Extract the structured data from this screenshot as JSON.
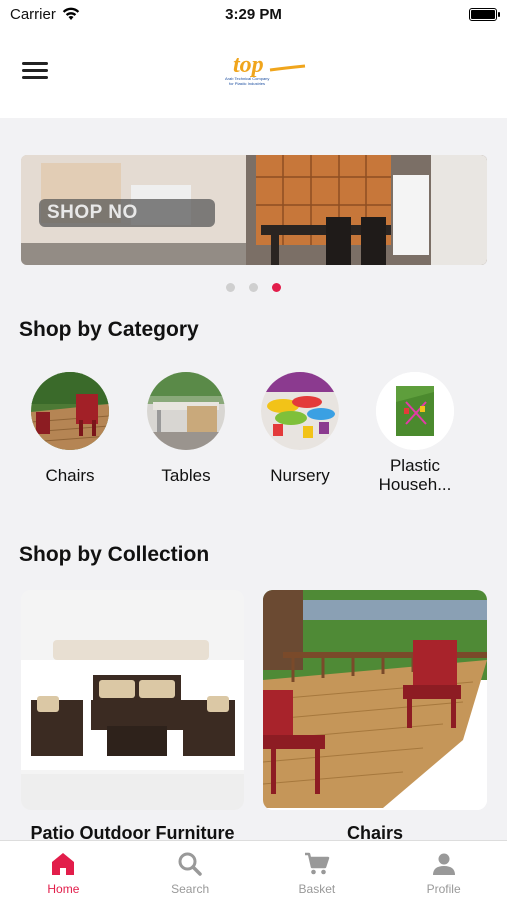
{
  "status": {
    "carrier": "Carrier",
    "time": "3:29 PM",
    "battery_level": 1.0
  },
  "header": {
    "logo_text": "top",
    "logo_subtitle_1": "Arab Technical Company",
    "logo_subtitle_2": "for Plastic Industries"
  },
  "banner": {
    "label": "SHOP NO",
    "slide_count": 3,
    "active_slide": 3
  },
  "categories": {
    "title": "Shop by Category",
    "items": [
      {
        "label": "Chairs"
      },
      {
        "label": "Tables"
      },
      {
        "label": "Nursery"
      },
      {
        "label": "Plastic Househ..."
      }
    ]
  },
  "collections": {
    "title": "Shop by Collection",
    "items": [
      {
        "label": "Patio Outdoor Furniture"
      },
      {
        "label": "Chairs"
      }
    ]
  },
  "tabs": [
    {
      "label": "Home",
      "icon": "home-icon",
      "active": true
    },
    {
      "label": "Search",
      "icon": "search-icon",
      "active": false
    },
    {
      "label": "Basket",
      "icon": "cart-icon",
      "active": false
    },
    {
      "label": "Profile",
      "icon": "profile-icon",
      "active": false
    }
  ],
  "colors": {
    "accent": "#e21d4a",
    "inactive": "#999999",
    "logo_orange": "#f0a51c",
    "logo_blue": "#1d4fa0"
  }
}
